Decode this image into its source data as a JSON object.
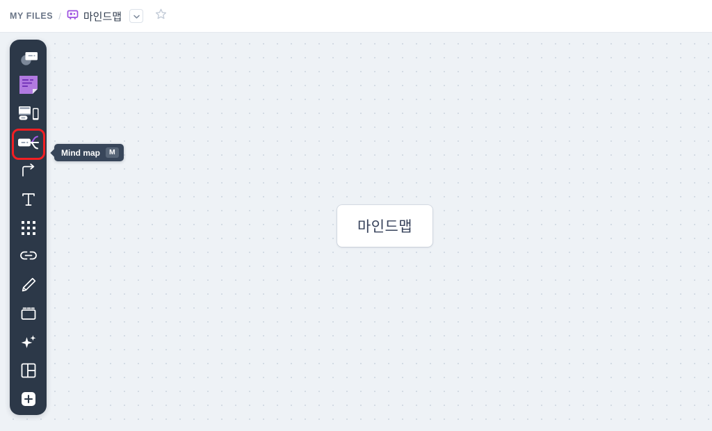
{
  "header": {
    "breadcrumb": {
      "root_label": "MY FILES",
      "separator": "/",
      "file_icon": "mindmap-file-icon",
      "file_name": "마인드맵",
      "dropdown_icon": "chevron-down-icon",
      "favorite_icon": "star-icon"
    }
  },
  "toolbar": {
    "items": [
      {
        "name": "shapes-tool",
        "icon": "shapes-icon",
        "label": "Shapes"
      },
      {
        "name": "sticky-note-tool",
        "icon": "sticky-note-icon",
        "label": "Sticky note"
      },
      {
        "name": "wireframe-tool",
        "icon": "wireframe-icon",
        "label": "Wireframe"
      },
      {
        "name": "mindmap-tool",
        "icon": "mindmap-icon",
        "label": "Mind map",
        "selected": true
      },
      {
        "name": "connector-tool",
        "icon": "arrow-connector-icon",
        "label": "Connector"
      },
      {
        "name": "text-tool",
        "icon": "text-icon",
        "label": "Text"
      },
      {
        "name": "table-tool",
        "icon": "grid-dots-icon",
        "label": "Table"
      },
      {
        "name": "link-tool",
        "icon": "link-icon",
        "label": "Link"
      },
      {
        "name": "pen-tool",
        "icon": "pencil-icon",
        "label": "Pen"
      },
      {
        "name": "frame-tool",
        "icon": "frame-icon",
        "label": "Frame"
      },
      {
        "name": "ai-tool",
        "icon": "sparkle-icon",
        "label": "AI"
      },
      {
        "name": "template-tool",
        "icon": "template-layout-icon",
        "label": "Templates"
      },
      {
        "name": "more-tool",
        "icon": "plus-square-icon",
        "label": "More"
      }
    ]
  },
  "tooltip": {
    "label": "Mind map",
    "shortcut": "M"
  },
  "canvas": {
    "nodes": [
      {
        "name": "mindmap-root-node",
        "label": "마인드맵"
      }
    ]
  },
  "colors": {
    "toolbar_bg": "#2c3848",
    "canvas_bg": "#eef2f6",
    "accent_purple": "#8b4fd8",
    "selection_red": "#f31f23",
    "tooltip_bg": "#38465a"
  }
}
